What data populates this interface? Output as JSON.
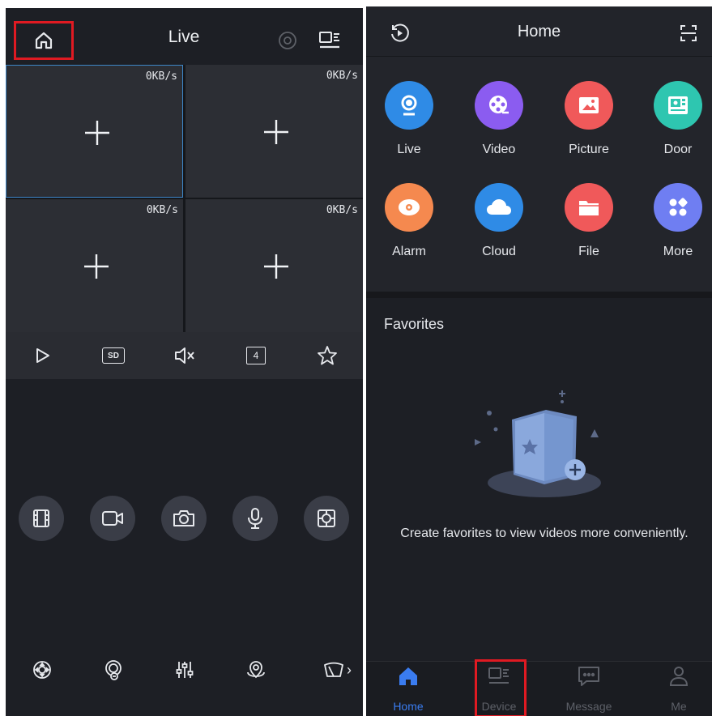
{
  "left": {
    "title": "Live",
    "cells": [
      {
        "rate": "0KB/s",
        "selected": true
      },
      {
        "rate": "0KB/s",
        "selected": false
      },
      {
        "rate": "0KB/s",
        "selected": false
      },
      {
        "rate": "0KB/s",
        "selected": false
      }
    ],
    "controls": [
      "play-icon",
      "sd-quality-icon",
      "mute-icon",
      "split-4-icon",
      "star-icon"
    ],
    "sd_label": "SD",
    "split_label": "4",
    "round_buttons": [
      "playback-film-icon",
      "record-video-icon",
      "snapshot-camera-icon",
      "talk-microphone-icon",
      "fisheye-icon"
    ],
    "bottom_icons": [
      "ptz-icon",
      "face-icon",
      "adjust-sliders-icon",
      "location-pin-icon",
      "wiper-icon"
    ],
    "more_arrow": "›"
  },
  "right": {
    "title": "Home",
    "apps": [
      {
        "label": "Live",
        "icon": "live-camera-icon",
        "color": "#2f8be6"
      },
      {
        "label": "Video",
        "icon": "video-reel-icon",
        "color": "#8b5cf0"
      },
      {
        "label": "Picture",
        "icon": "picture-icon",
        "color": "#f0595a"
      },
      {
        "label": "Door",
        "icon": "door-icon",
        "color": "#2ec6b0"
      },
      {
        "label": "Alarm",
        "icon": "alarm-icon",
        "color": "#f5894f"
      },
      {
        "label": "Cloud",
        "icon": "cloud-icon",
        "color": "#2f8be6"
      },
      {
        "label": "File",
        "icon": "folder-icon",
        "color": "#f0595a"
      },
      {
        "label": "More",
        "icon": "more-grid-icon",
        "color": "#6f7ef2"
      }
    ],
    "favorites_title": "Favorites",
    "favorites_message": "Create favorites to view videos more conveniently.",
    "nav": [
      {
        "label": "Home",
        "icon": "home-icon",
        "active": true
      },
      {
        "label": "Device",
        "icon": "device-icon",
        "active": false
      },
      {
        "label": "Message",
        "icon": "message-icon",
        "active": false
      },
      {
        "label": "Me",
        "icon": "user-icon",
        "active": false
      }
    ]
  },
  "colors": {
    "accent": "#3a7cf0",
    "highlight": "#e01a22",
    "background": "#1d1f25"
  }
}
